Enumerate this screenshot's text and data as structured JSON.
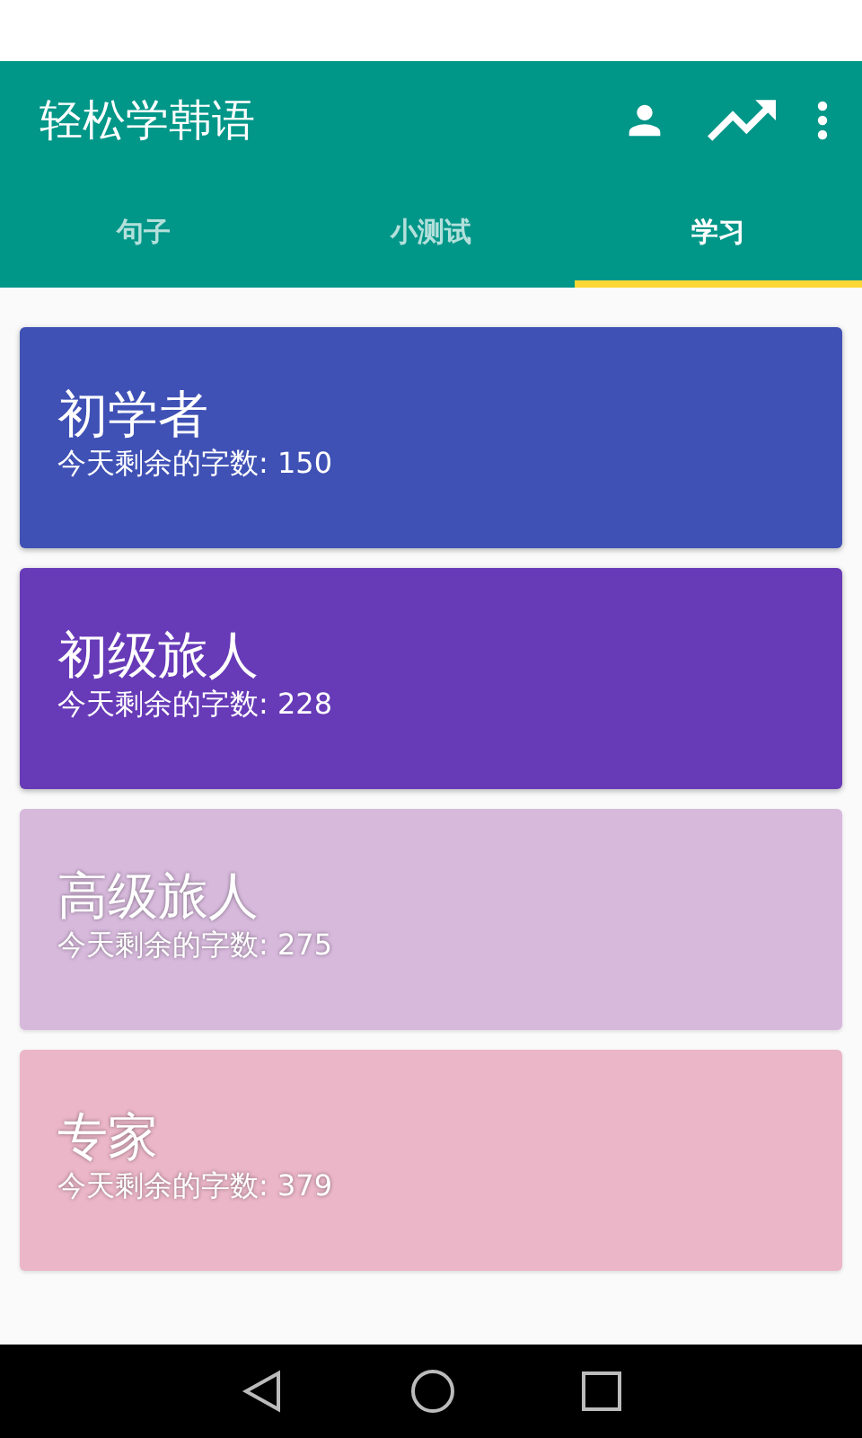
{
  "app_bar": {
    "title": "轻松学韩语"
  },
  "tabs": [
    {
      "label": "句子",
      "selected": false
    },
    {
      "label": "小测试",
      "selected": false
    },
    {
      "label": "学习",
      "selected": true
    }
  ],
  "levels": [
    {
      "name": "初学者",
      "remaining": "今天剩余的字数: 150",
      "color": "#3f51b5",
      "disabled": false
    },
    {
      "name": "初级旅人",
      "remaining": "今天剩余的字数: 228",
      "color": "#673ab7",
      "disabled": false
    },
    {
      "name": "高级旅人",
      "remaining": "今天剩余的字数: 275",
      "color": "#d7b9dc",
      "disabled": true
    },
    {
      "name": "专家",
      "remaining": "今天剩余的字数: 379",
      "color": "#ebb6c7",
      "disabled": true
    }
  ]
}
